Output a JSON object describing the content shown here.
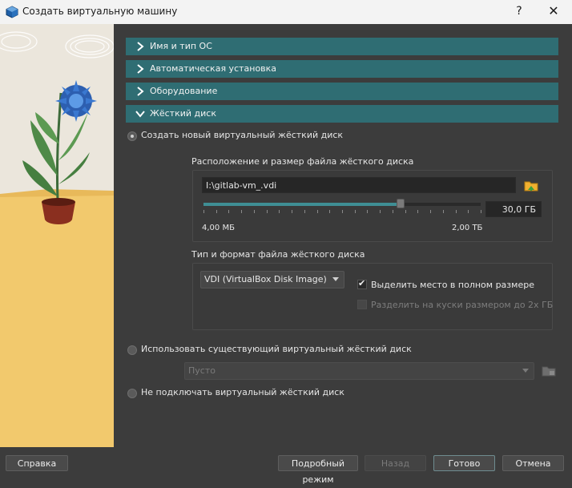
{
  "window": {
    "title": "Создать виртуальную машину",
    "help_label": "?",
    "close_label": "✕"
  },
  "sections": [
    {
      "label": "Имя и тип ОС",
      "expanded": false
    },
    {
      "label": "Автоматическая установка",
      "expanded": false
    },
    {
      "label": "Оборудование",
      "expanded": false
    },
    {
      "label": "Жёсткий диск",
      "expanded": true
    }
  ],
  "disk": {
    "create_new_label": "Создать новый виртуальный жёсткий диск",
    "create_new_selected": true,
    "location_group_label": "Расположение и размер файла жёсткого диска",
    "path_value": "I:\\gitlab-vm_.vdi",
    "size_value": "30,0 ГБ",
    "size_fraction": 0.71,
    "min_label": "4,00 МБ",
    "max_label": "2,00 ТБ",
    "format_group_label": "Тип и формат файла жёсткого диска",
    "format_selected": "VDI (VirtualBox Disk Image)",
    "preallocate_label": "Выделить место в полном размере",
    "preallocate_checked": true,
    "split_label": "Разделить на куски размером до 2х ГБ",
    "split_checked": false,
    "use_existing_label": "Использовать существующий виртуальный жёсткий диск",
    "existing_selected": "Пусто",
    "no_disk_label": "Не подключать виртуальный жёсткий диск"
  },
  "buttons": {
    "help": "Справка",
    "expert_mode": "Подробный режим",
    "back": "Назад",
    "finish": "Готово",
    "cancel": "Отмена"
  },
  "colors": {
    "section_header": "#2f6d73",
    "background": "#3c3c3c",
    "accent": "#3f8e94"
  }
}
